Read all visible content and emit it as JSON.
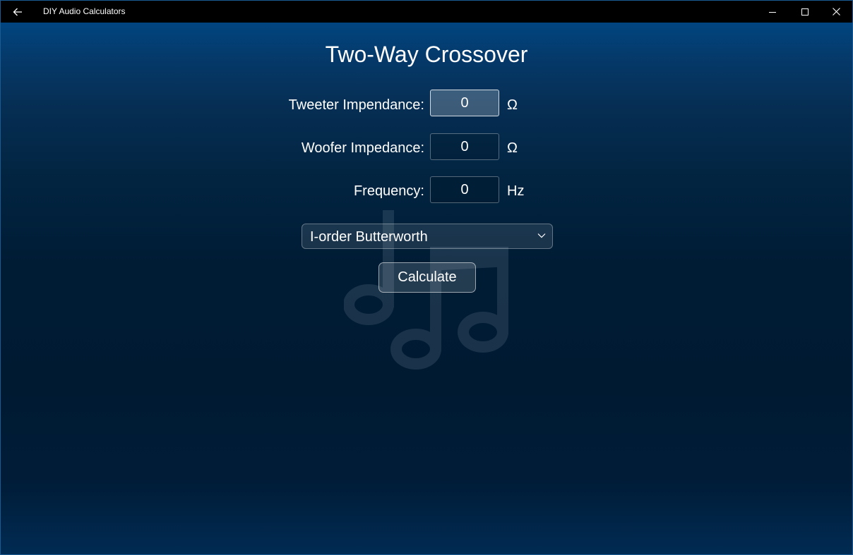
{
  "window": {
    "title": "DIY Audio Calculators",
    "back_icon": "back-arrow-icon",
    "minimize_icon": "minimize-icon",
    "maximize_icon": "maximize-icon",
    "close_icon": "close-icon"
  },
  "page": {
    "title": "Two-Way Crossover",
    "background_art_icon": "music-notes-icon"
  },
  "form": {
    "tweeter": {
      "label": "Tweeter Impendance:",
      "value": "0",
      "unit": "Ω"
    },
    "woofer": {
      "label": "Woofer Impedance:",
      "value": "0",
      "unit": "Ω"
    },
    "frequency": {
      "label": "Frequency:",
      "value": "0",
      "unit": "Hz"
    },
    "filter_type": {
      "selected": "I-order Butterworth",
      "icon": "chevron-down-icon"
    },
    "calculate_label": "Calculate"
  },
  "colors": {
    "titlebar": "#000000",
    "window_border": "#1b5b94",
    "gradient_top": "#014580",
    "gradient_middle": "#001a32",
    "gradient_bottom": "#012b53",
    "text": "#ffffff"
  }
}
